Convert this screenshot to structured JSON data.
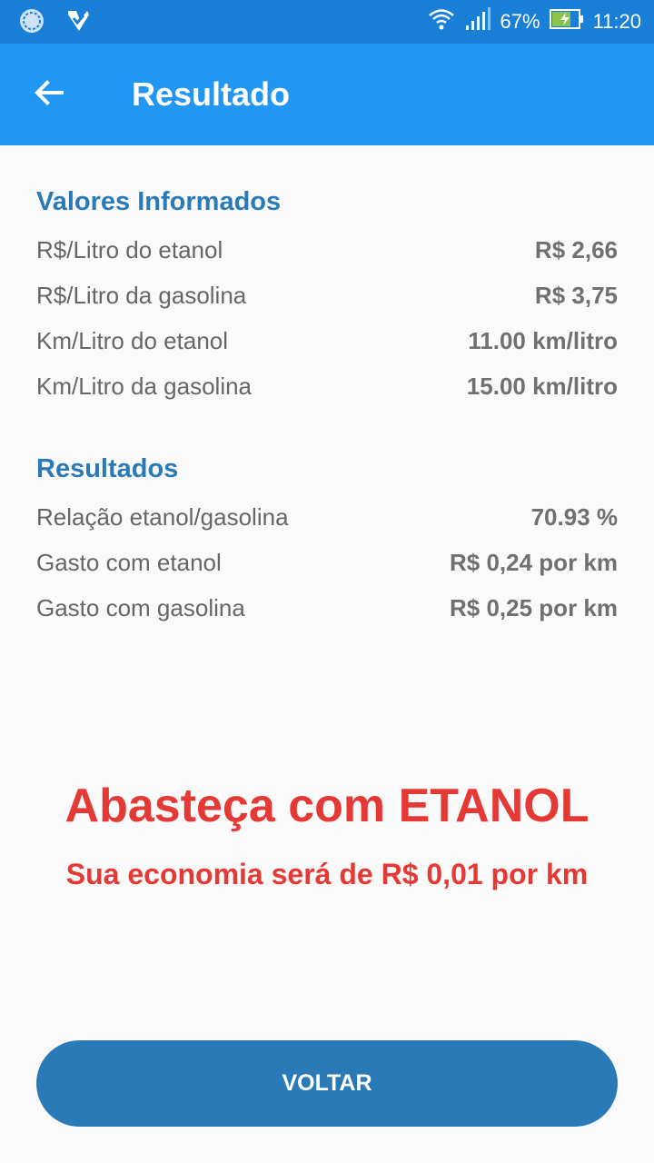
{
  "status_bar": {
    "battery": "67%",
    "time": "11:20",
    "icons": [
      "app-sync-icon",
      "app-check-icon",
      "wifi-icon",
      "signal-icon",
      "battery-charging-icon"
    ]
  },
  "app_bar": {
    "title": "Resultado",
    "back_icon": "arrow-back-icon"
  },
  "informed": {
    "title": "Valores Informados",
    "rows": [
      {
        "label": "R$/Litro do etanol",
        "value": "R$ 2,66"
      },
      {
        "label": "R$/Litro da gasolina",
        "value": "R$ 3,75"
      },
      {
        "label": "Km/Litro do etanol",
        "value": "11.00 km/litro"
      },
      {
        "label": "Km/Litro da gasolina",
        "value": "15.00 km/litro"
      }
    ]
  },
  "results": {
    "title": "Resultados",
    "rows": [
      {
        "label": "Relação etanol/gasolina",
        "value": "70.93 %"
      },
      {
        "label": "Gasto com etanol",
        "value": "R$ 0,24 por km"
      },
      {
        "label": "Gasto com gasolina",
        "value": "R$ 0,25 por km"
      }
    ]
  },
  "verdict": {
    "main": "Abasteça com ETANOL",
    "sub": "Sua economia será de R$ 0,01 por km"
  },
  "button": {
    "label": "VOLTAR"
  },
  "colors": {
    "status_bar": "#1a7fd6",
    "app_bar": "#2196f3",
    "accent": "#2a7ab8",
    "verdict": "#e53935"
  }
}
